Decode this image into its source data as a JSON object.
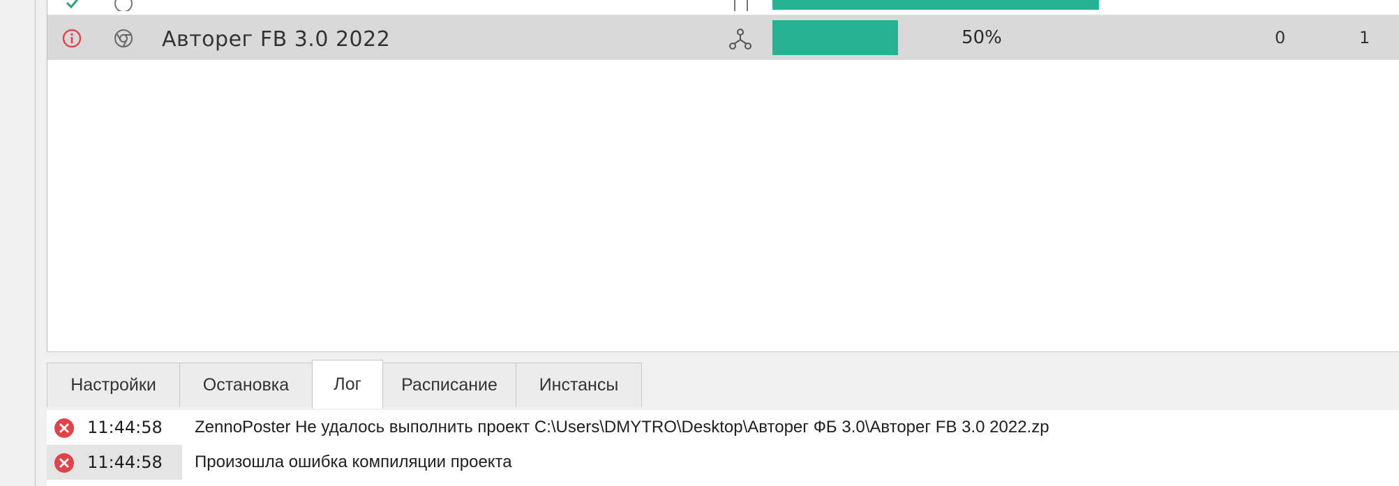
{
  "tasks": {
    "selected_row": {
      "name": "Авторег FB 3.0 2022",
      "progress_label": "50%",
      "progress_fraction": 0.5,
      "col_a": "0",
      "col_b": "1",
      "status_icon": "error-circle-icon",
      "browser_icon": "chrome-icon",
      "type_icon": "network-tree-icon",
      "progress_color": "#26b394"
    },
    "partial_row": {
      "progress_fraction": 0.78,
      "progress_color": "#26b394"
    }
  },
  "tabs": [
    {
      "label": "Настройки",
      "active": false
    },
    {
      "label": "Остановка",
      "active": false
    },
    {
      "label": "Лог",
      "active": true
    },
    {
      "label": "Расписание",
      "active": false
    },
    {
      "label": "Инстансы",
      "active": false
    }
  ],
  "log": [
    {
      "time": "11:44:58",
      "message": "ZennoPoster Не удалось выполнить проект C:\\Users\\DMYTRO\\Desktop\\Авторег ФБ 3.0\\Авторег FB 3.0 2022.zp",
      "icon": "error-x-icon"
    },
    {
      "time": "11:44:58",
      "message": "Произошла ошибка компиляции проекта",
      "icon": "error-x-icon"
    }
  ],
  "colors": {
    "accent": "#26b394",
    "error": "#e0444b",
    "selected_row": "#d9d9d9"
  }
}
